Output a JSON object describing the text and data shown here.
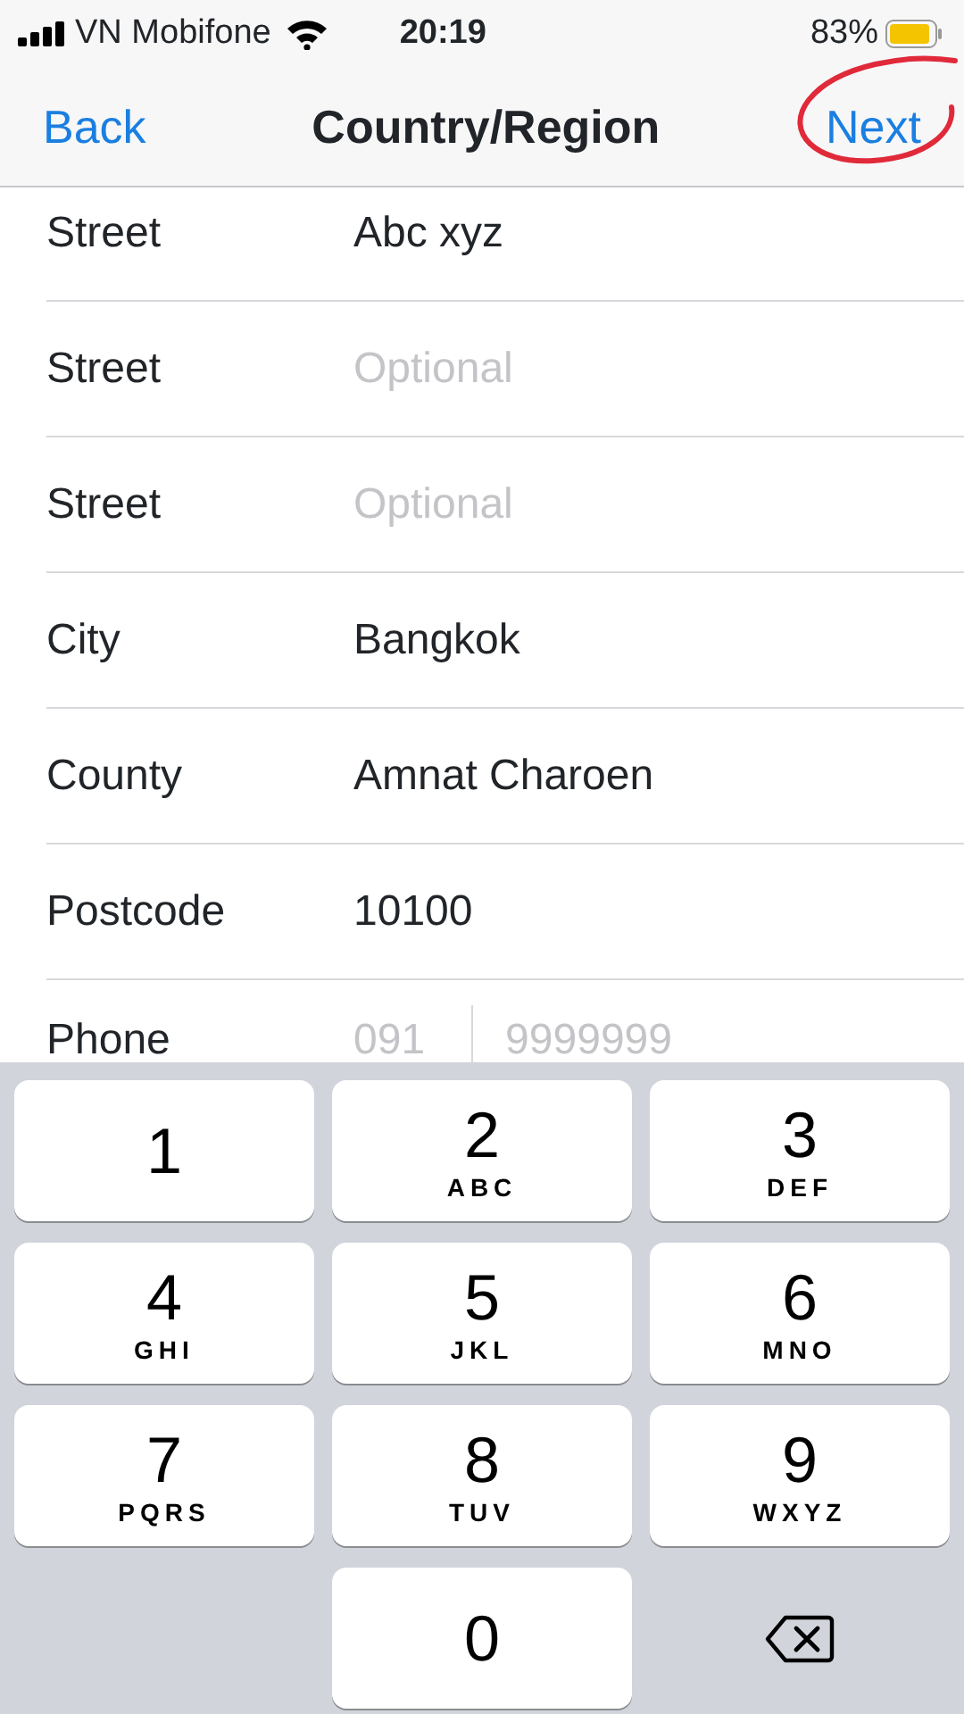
{
  "status_bar": {
    "carrier": "VN Mobifone",
    "time": "20:19",
    "battery": "83%"
  },
  "nav": {
    "back": "Back",
    "title": "Country/Region",
    "next": "Next"
  },
  "fields": [
    {
      "label": "Street",
      "value": "Abc xyz"
    },
    {
      "label": "Street",
      "placeholder": "Optional"
    },
    {
      "label": "Street",
      "placeholder": "Optional"
    },
    {
      "label": "City",
      "value": "Bangkok"
    },
    {
      "label": "County",
      "value": "Amnat Charoen"
    },
    {
      "label": "Postcode",
      "value": "10100"
    }
  ],
  "phone_field": {
    "label": "Phone",
    "area_placeholder": "091",
    "number_placeholder": "9999999"
  },
  "keys": [
    {
      "kind": "digit",
      "digit": "1"
    },
    {
      "kind": "digit",
      "digit": "2",
      "letters": "ABC"
    },
    {
      "kind": "digit",
      "digit": "3",
      "letters": "DEF"
    },
    {
      "kind": "digit",
      "digit": "4",
      "letters": "GHI"
    },
    {
      "kind": "digit",
      "digit": "5",
      "letters": "JKL"
    },
    {
      "kind": "digit",
      "digit": "6",
      "letters": "MNO"
    },
    {
      "kind": "digit",
      "digit": "7",
      "letters": "PQRS"
    },
    {
      "kind": "digit",
      "digit": "8",
      "letters": "TUV"
    },
    {
      "kind": "digit",
      "digit": "9",
      "letters": "WXYZ"
    },
    {
      "kind": "blank"
    },
    {
      "kind": "digit",
      "digit": "0"
    },
    {
      "kind": "delete"
    }
  ]
}
